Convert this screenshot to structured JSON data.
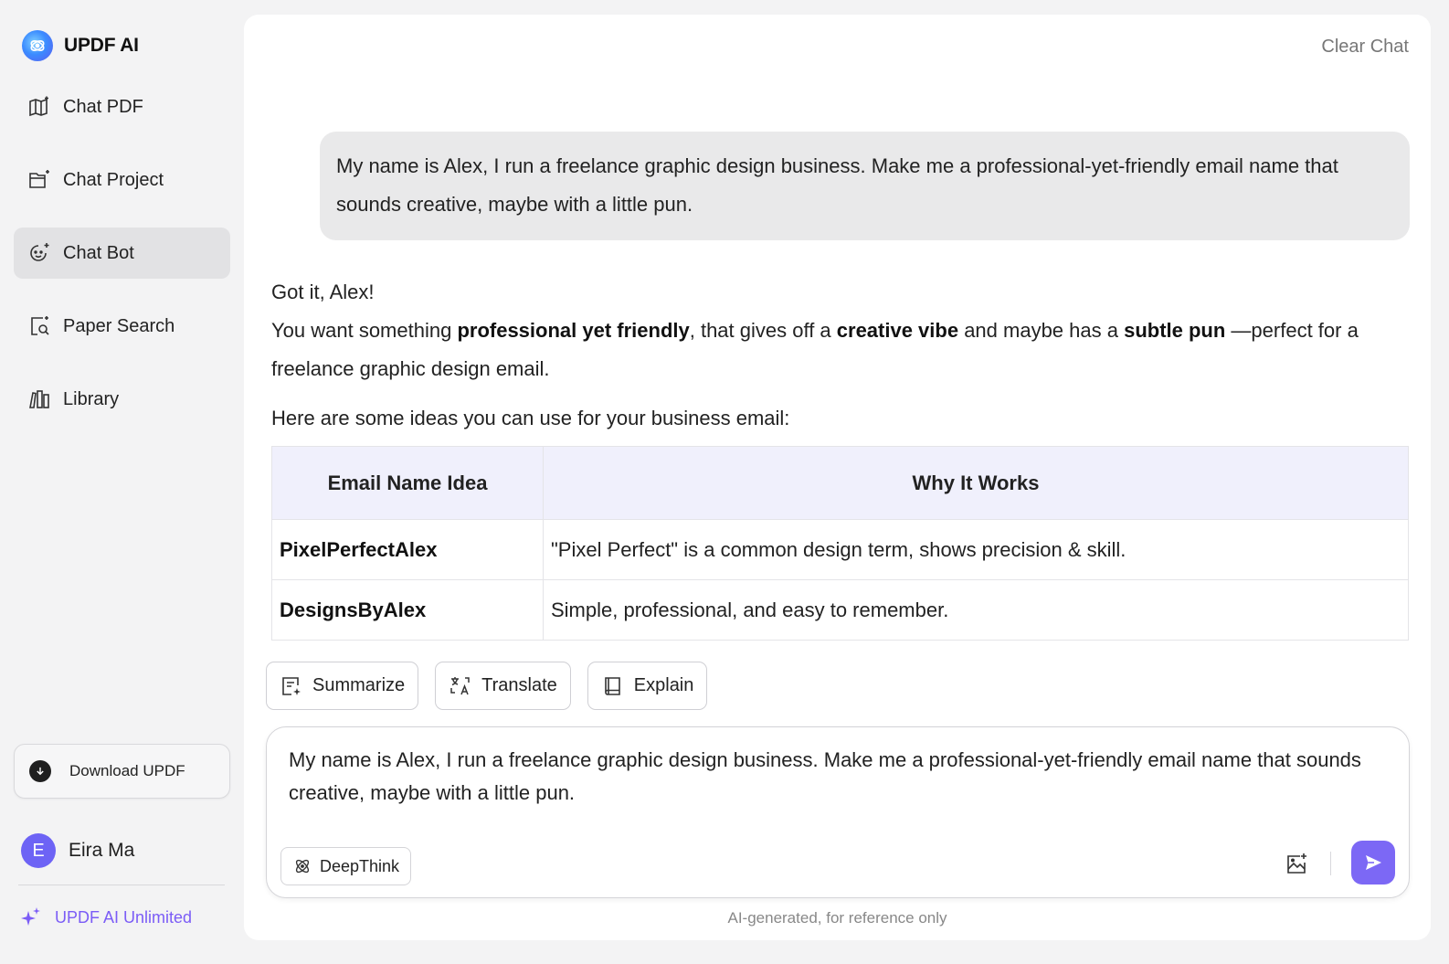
{
  "brand": {
    "name": "UPDF AI"
  },
  "sidebar": {
    "items": [
      {
        "label": "Chat PDF",
        "icon": "book-sparkle-icon"
      },
      {
        "label": "Chat Project",
        "icon": "folder-sparkle-icon"
      },
      {
        "label": "Chat Bot",
        "icon": "bot-face-icon",
        "active": true
      },
      {
        "label": "Paper Search",
        "icon": "doc-search-icon"
      },
      {
        "label": "Library",
        "icon": "library-icon"
      }
    ],
    "download_label": "Download UPDF",
    "user": {
      "initial": "E",
      "name": "Eira Ma"
    },
    "unlimited_label": "UPDF AI Unlimited"
  },
  "header": {
    "clear_chat": "Clear Chat"
  },
  "chat": {
    "user_message": "My name is Alex, I run a freelance graphic design business. Make me a professional-yet-friendly email name that sounds creative, maybe with a little pun.",
    "reply": {
      "greeting": "Got it, Alex!",
      "line_parts": {
        "p1": "You want something ",
        "b1": "professional yet friendly",
        "p2": ", that gives off a ",
        "b2": "creative vibe",
        "p3": " and maybe has a ",
        "b3": "subtle pun",
        "p4": " —perfect for a freelance graphic design email."
      },
      "intro": "Here are some ideas you can use for your business email:",
      "table": {
        "headers": [
          "Email Name Idea",
          "Why It Works"
        ],
        "rows": [
          {
            "name": "PixelPerfectAlex",
            "why": "\"Pixel Perfect\" is a common design term, shows precision & skill."
          },
          {
            "name": "DesignsByAlex",
            "why": "Simple, professional, and easy to remember."
          }
        ]
      }
    }
  },
  "quick_actions": [
    {
      "label": "Summarize",
      "icon": "summarize-icon"
    },
    {
      "label": "Translate",
      "icon": "translate-icon"
    },
    {
      "label": "Explain",
      "icon": "book-icon"
    }
  ],
  "composer": {
    "value": "My name is Alex, I run a freelance graphic design business. Make me a professional-yet-friendly email name that sounds creative, maybe with a little pun.",
    "deepthink_label": "DeepThink"
  },
  "disclaimer": "AI-generated, for reference only",
  "colors": {
    "accent": "#7c68f5",
    "active_nav": "#e2e2e4",
    "table_header": "#f0f0fc"
  }
}
